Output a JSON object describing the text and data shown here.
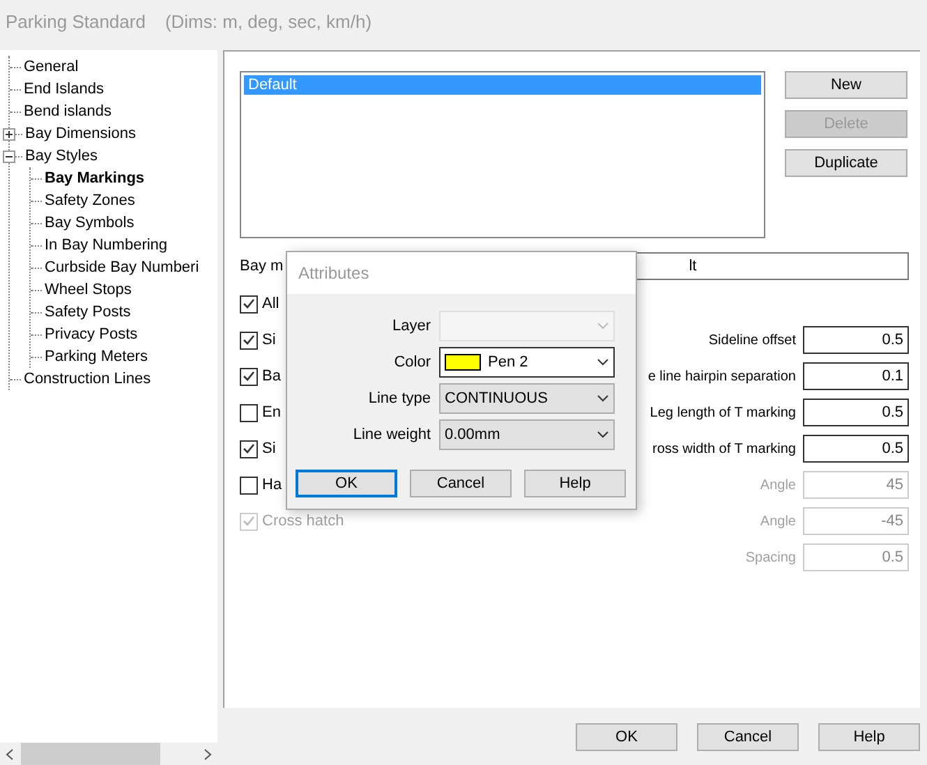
{
  "window": {
    "title": "Parking Standard",
    "subtitle": "(Dims: m, deg, sec, km/h)"
  },
  "tree": [
    {
      "label": "General",
      "selected": false
    },
    {
      "label": "End Islands",
      "selected": false
    },
    {
      "label": "Bend islands",
      "selected": false
    },
    {
      "label": "Bay Dimensions",
      "selected": false,
      "expanded": false
    },
    {
      "label": "Bay Styles",
      "selected": false,
      "expanded": true,
      "children": [
        {
          "label": "Bay Markings",
          "selected": true
        },
        {
          "label": "Safety Zones",
          "selected": false
        },
        {
          "label": "Bay Symbols",
          "selected": false
        },
        {
          "label": "In Bay Numbering",
          "selected": false
        },
        {
          "label": "Curbside Bay Numberi",
          "selected": false
        },
        {
          "label": "Wheel Stops",
          "selected": false
        },
        {
          "label": "Safety Posts",
          "selected": false
        },
        {
          "label": "Privacy Posts",
          "selected": false
        },
        {
          "label": "Parking Meters",
          "selected": false
        }
      ]
    },
    {
      "label": "Construction Lines",
      "selected": false
    }
  ],
  "styles_list": [
    {
      "label": "Default",
      "selected": true
    }
  ],
  "list_buttons": [
    {
      "label": "New",
      "disabled": false
    },
    {
      "label": "Delete",
      "disabled": true
    },
    {
      "label": "Duplicate",
      "disabled": false
    }
  ],
  "name_field": {
    "label": "Bay m",
    "value": "lt"
  },
  "options": [
    {
      "label": "All",
      "checked": true,
      "disabled": false
    },
    {
      "label": "Si",
      "checked": true,
      "disabled": false,
      "field_label": "Sideline offset",
      "field_value": "0.5",
      "field_disabled": false
    },
    {
      "label": "Ba",
      "checked": true,
      "disabled": false,
      "field_label": "e line hairpin separation",
      "field_value": "0.1",
      "field_disabled": false
    },
    {
      "label": "En",
      "checked": false,
      "disabled": false,
      "field_label": "Leg length of T marking",
      "field_value": "0.5",
      "field_disabled": false
    },
    {
      "label": "Si",
      "checked": true,
      "disabled": false,
      "field_label": "ross width of T marking",
      "field_value": "0.5",
      "field_disabled": false
    },
    {
      "label": "Ha",
      "checked": false,
      "disabled": false,
      "field_label": "Angle",
      "field_value": "45",
      "field_disabled": true
    },
    {
      "label": "Cross hatch",
      "checked": true,
      "disabled": true,
      "field_label": "Angle",
      "field_value": "-45",
      "field_disabled": true
    },
    {
      "field_label": "Spacing",
      "field_value": "0.5",
      "field_disabled": true
    }
  ],
  "footer_buttons": [
    "OK",
    "Cancel",
    "Help"
  ],
  "dialog": {
    "title": "Attributes",
    "fields": [
      {
        "label": "Layer",
        "disabled": true
      },
      {
        "label": "Color",
        "value": "Pen 2",
        "color": "#ffff00",
        "disabled": false
      },
      {
        "label": "Line type",
        "value": "CONTINUOUS",
        "disabled": false
      },
      {
        "label": "Line weight",
        "value": "0.00mm",
        "disabled": false
      }
    ],
    "buttons": [
      {
        "label": "OK",
        "selected": true
      },
      {
        "label": "Cancel",
        "selected": false
      },
      {
        "label": "Help",
        "selected": false
      }
    ]
  }
}
